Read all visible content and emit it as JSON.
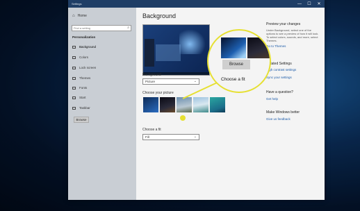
{
  "window": {
    "title": "Settings",
    "controls": {
      "minimize": "—",
      "maximize": "☐",
      "close": "✕"
    }
  },
  "sidebar": {
    "home_label": "Home",
    "search_placeholder": "Find a setting",
    "section_title": "Personalization",
    "items": [
      {
        "label": "Background",
        "icon": "image-icon"
      },
      {
        "label": "Colors",
        "icon": "palette-icon"
      },
      {
        "label": "Lock screen",
        "icon": "lock-screen-icon"
      },
      {
        "label": "Themes",
        "icon": "brush-icon"
      },
      {
        "label": "Fonts",
        "icon": "font-icon"
      },
      {
        "label": "Start",
        "icon": "start-icon"
      },
      {
        "label": "Taskbar",
        "icon": "taskbar-icon"
      }
    ]
  },
  "main": {
    "title": "Background",
    "background_label": "Background",
    "background_value": "Picture",
    "choose_picture_label": "Choose your picture",
    "browse_label": "Browse",
    "choose_fit_label": "Choose a fit",
    "fit_value": "Fill"
  },
  "right": {
    "preview_heading": "Preview your changes",
    "preview_text": "Under Background, select one of the options to see a preview of how it will look. To select colors, sounds, and more, select Themes.",
    "go_to_themes": "Go to Themes",
    "related_heading": "Related Settings",
    "high_contrast": "High contrast settings",
    "sync_settings": "Sync your settings",
    "question_heading": "Have a question?",
    "get_help": "Get help",
    "better_heading": "Make Windows better",
    "feedback": "Give us feedback"
  },
  "zoom": {
    "browse_label": "Browse",
    "fit_label": "Choose a fit"
  },
  "colors": {
    "accent_link": "#1a5aa8",
    "callout": "#e6e032",
    "titlebar": "#1f3e66",
    "sidebar": "#c9ced4"
  }
}
